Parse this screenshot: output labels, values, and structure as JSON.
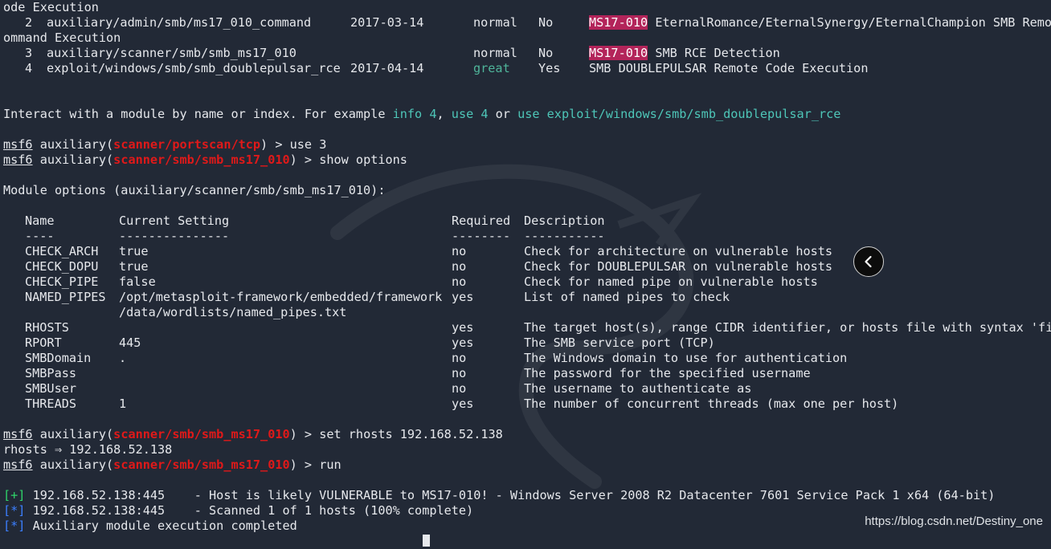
{
  "top": {
    "row2": {
      "num": "2",
      "name": "auxiliary/admin/smb/ms17_010_command",
      "date": "2017-03-14",
      "rank": "normal",
      "check": "No",
      "badge": "MS17-010",
      "desc": "EternalRomance/EternalSynergy/EternalChampion SMB Remot",
      "wrap": "ommand Execution"
    },
    "row3": {
      "num": "3",
      "name": "auxiliary/scanner/smb/smb_ms17_010",
      "rank": "normal",
      "check": "No",
      "badge": "MS17-010",
      "desc": "SMB RCE Detection"
    },
    "row4": {
      "num": "4",
      "name": "exploit/windows/smb/smb_doublepulsar_rce",
      "date": "2017-04-14",
      "rank": "great",
      "check": "Yes",
      "desc": "SMB DOUBLEPULSAR Remote Code Execution"
    },
    "line0": "ode Execution"
  },
  "interact": {
    "prefix": "Interact with a module by name or index. For example ",
    "info": "info 4",
    "sep1": ", ",
    "use": "use 4",
    "or": " or ",
    "use_path": "use exploit/windows/smb/smb_doublepulsar_rce"
  },
  "prompts": {
    "msf": "msf6",
    "type": " auxiliary(",
    "mod1": "scanner/portscan/tcp",
    "mod2": "scanner/smb/smb_ms17_010",
    "close": ") > ",
    "cmd1": "use 3",
    "cmd2": "show options",
    "cmd3": "set rhosts 192.168.52.138",
    "cmd4": "run"
  },
  "module_options_title": "Module options (auxiliary/scanner/smb/smb_ms17_010):",
  "options": {
    "headers": [
      "Name",
      "Current Setting",
      "Required",
      "Description"
    ],
    "dashes": [
      "----",
      "---------------",
      "--------",
      "-----------"
    ],
    "rows": [
      [
        "CHECK_ARCH",
        "true",
        "no",
        "Check for architecture on vulnerable hosts"
      ],
      [
        "CHECK_DOPU",
        "true",
        "no",
        "Check for DOUBLEPULSAR on vulnerable hosts"
      ],
      [
        "CHECK_PIPE",
        "false",
        "no",
        "Check for named pipe on vulnerable hosts"
      ],
      [
        "NAMED_PIPES",
        "/opt/metasploit-framework/embedded/framework",
        "yes",
        "List of named pipes to check"
      ],
      [
        "",
        "/data/wordlists/named_pipes.txt",
        "",
        ""
      ],
      [
        "RHOSTS",
        "",
        "yes",
        "The target host(s), range CIDR identifier, or hosts file with syntax 'fil"
      ],
      [
        "RPORT",
        "445",
        "yes",
        "The SMB service port (TCP)"
      ],
      [
        "SMBDomain",
        ".",
        "no",
        "The Windows domain to use for authentication"
      ],
      [
        "SMBPass",
        "",
        "no",
        "The password for the specified username"
      ],
      [
        "SMBUser",
        "",
        "no",
        "The username to authenticate as"
      ],
      [
        "THREADS",
        "1",
        "yes",
        "The number of concurrent threads (max one per host)"
      ]
    ]
  },
  "rhosts_echo": "rhosts ⇒ 192.168.52.138",
  "results": [
    {
      "marker": "[+]",
      "text": " 192.168.52.138:445    - Host is likely VULNERABLE to MS17-010! - Windows Server 2008 R2 Datacenter 7601 Service Pack 1 x64 (64-bit)"
    },
    {
      "marker": "[*]",
      "text": " 192.168.52.138:445    - Scanned 1 of 1 hosts (100% complete)"
    },
    {
      "marker": "[*]",
      "text": " Auxiliary module execution completed"
    }
  ],
  "watermark": "https://blog.csdn.net/Destiny_one",
  "icons": {
    "back": "chevron-left-icon"
  }
}
